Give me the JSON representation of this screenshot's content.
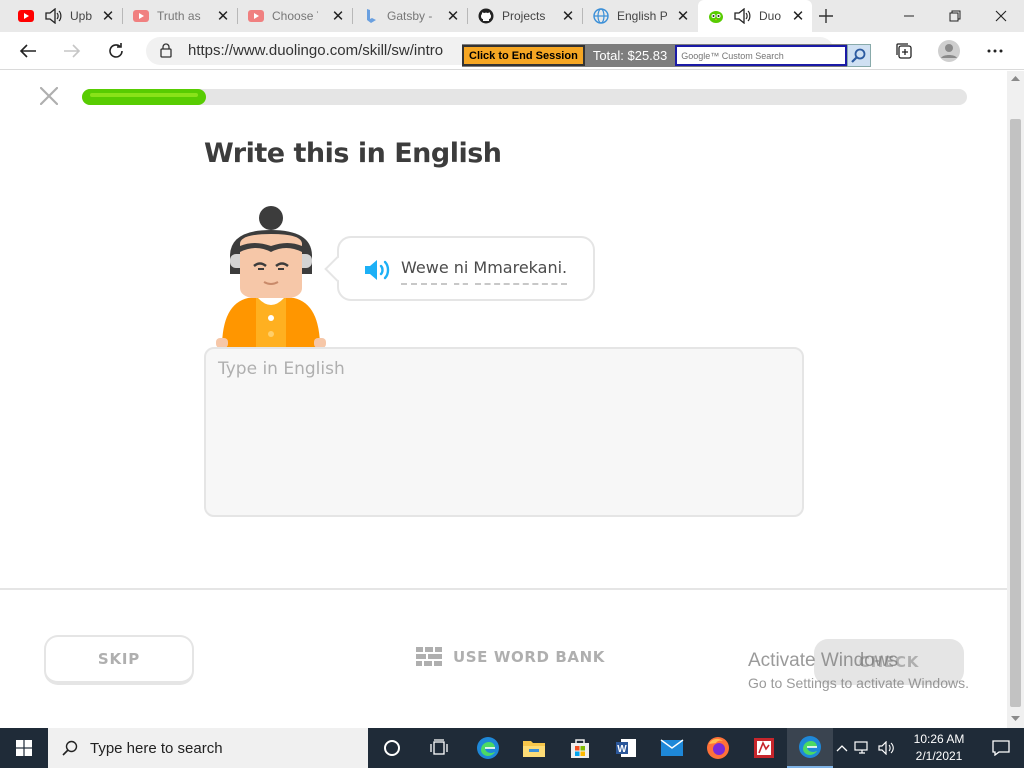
{
  "browser": {
    "tabs": [
      {
        "label": "Upb",
        "icon": "youtube-icon",
        "audio": true
      },
      {
        "label": "Truth as t",
        "icon": "youtube-icon",
        "audio": false
      },
      {
        "label": "Choose Y",
        "icon": "youtube-icon",
        "audio": false
      },
      {
        "label": "Gatsby -",
        "icon": "bing-icon",
        "audio": false
      },
      {
        "label": "Projects",
        "icon": "github-icon",
        "audio": false
      },
      {
        "label": "English P",
        "icon": "globe-icon",
        "audio": false
      },
      {
        "label": "Duo",
        "icon": "duolingo-icon",
        "audio": true,
        "active": true
      }
    ],
    "url": "https://www.duolingo.com/skill/sw/intro",
    "extension": {
      "end_session_label": "Click to End Session",
      "total_label": "Total: $25.83",
      "search_placeholder": "Google™ Custom Search"
    }
  },
  "lesson": {
    "progress": 0.14,
    "title": "Write this in English",
    "prompt": "Wewe ni Mmarekani.",
    "answer_placeholder": "Type in English",
    "answer_value": "",
    "skip_label": "SKIP",
    "word_bank_label": "USE WORD BANK",
    "check_label": "CHECK"
  },
  "watermark": {
    "title": "Activate Windows",
    "subtitle": "Go to Settings to activate Windows."
  },
  "taskbar": {
    "search_placeholder": "Type here to search",
    "time": "10:26 AM",
    "date": "2/1/2021",
    "apps": [
      "task-view-icon",
      "edge-icon",
      "file-explorer-icon",
      "store-icon",
      "word-icon",
      "mail-icon",
      "firefox-icon",
      "pdf-app-icon",
      "edge-active-icon"
    ]
  },
  "colors": {
    "progress_green": "#58cc02",
    "title_text": "#3c3c3c",
    "speaker_blue": "#1cb0f6",
    "disabled_text": "#afafaf",
    "taskbar_bg": "#1f2b38"
  }
}
